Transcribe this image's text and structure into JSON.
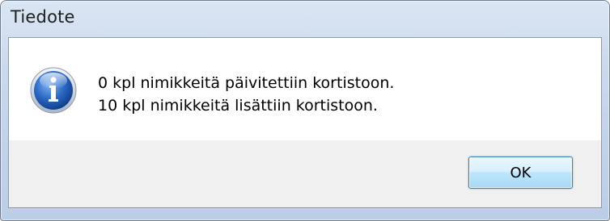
{
  "window": {
    "title": "Tiedote"
  },
  "dialog": {
    "icon": "info-icon",
    "message_lines": [
      "0 kpl nimikkeitä päivitettiin kortistoon.",
      "10 kpl nimikkeitä lisättiin kortistoon."
    ]
  },
  "buttons": {
    "ok_label": "OK"
  },
  "colors": {
    "frame": "#c3d3ea",
    "content_bg": "#ffffff",
    "button_bar_bg": "#f0f0f0",
    "ok_border": "#3c7fb1",
    "icon_blue": "#1f5fb8"
  }
}
